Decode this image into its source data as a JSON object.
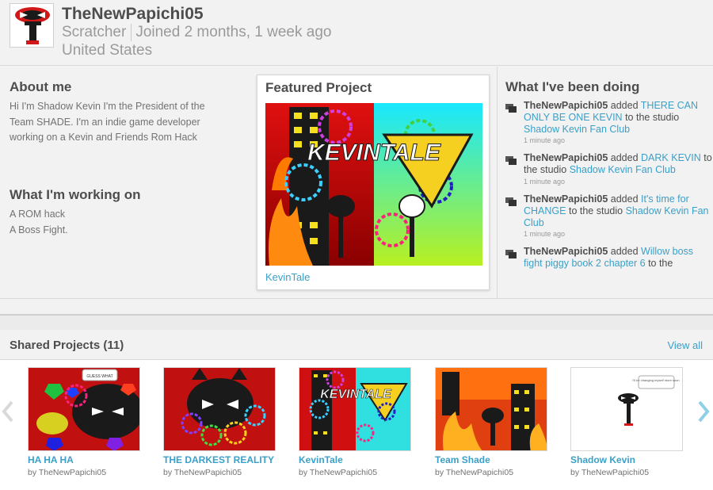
{
  "profile": {
    "username": "TheNewPapichi05",
    "role": "Scratcher",
    "joined": "Joined 2 months, 1 week ago",
    "country": "United States"
  },
  "about": {
    "title": "About me",
    "text": "Hi I'm Shadow Kevin I'm the President of the Team SHADE. I'm an indie game developer working on a Kevin and Friends Rom Hack"
  },
  "working_on": {
    "title": "What I'm working on",
    "lines": [
      "A ROM hack",
      "A Boss Fight."
    ]
  },
  "featured": {
    "title": "Featured Project",
    "project_title": "KevinTale",
    "thumb_text": "KEVINTALE"
  },
  "activity": {
    "title": "What I've been doing",
    "items": [
      {
        "user": "TheNewPapichi05",
        "verb": "added",
        "project": "THERE CAN ONLY BE ONE KEVIN",
        "mid": "to the studio",
        "studio": "Shadow Kevin Fan Club",
        "time": "1 minute ago"
      },
      {
        "user": "TheNewPapichi05",
        "verb": "added",
        "project": "DARK KEVIN",
        "mid": "to the studio",
        "studio": "Shadow Kevin Fan Club",
        "time": "1 minute ago"
      },
      {
        "user": "TheNewPapichi05",
        "verb": "added",
        "project": "It's time for CHANGE",
        "mid": "to the studio",
        "studio": "Shadow Kevin Fan Club",
        "time": "1 minute ago"
      },
      {
        "user": "TheNewPapichi05",
        "verb": "added",
        "project": "Willow boss fight piggy book 2 chapter 6",
        "mid": "to the",
        "studio": "",
        "time": ""
      }
    ]
  },
  "shared": {
    "title": "Shared Projects (11)",
    "view_all": "View all",
    "projects": [
      {
        "title": "HA HA HA",
        "by": "by TheNewPapichi05",
        "bubble": "GUESS WHAT"
      },
      {
        "title": "THE DARKEST REALITY",
        "by": "by TheNewPapichi05"
      },
      {
        "title": "KevinTale",
        "by": "by TheNewPapichi05",
        "thumb_text": "KEVINTALE"
      },
      {
        "title": "Team Shade",
        "by": "by TheNewPapichi05"
      },
      {
        "title": "Shadow Kevin",
        "by": "by TheNewPapichi05",
        "bubble": "I'll be changing myself more soon"
      }
    ]
  },
  "colors": {
    "link": "#3aa0c9",
    "heading": "#4d4d4d",
    "arrow": "#8fd0e8"
  }
}
